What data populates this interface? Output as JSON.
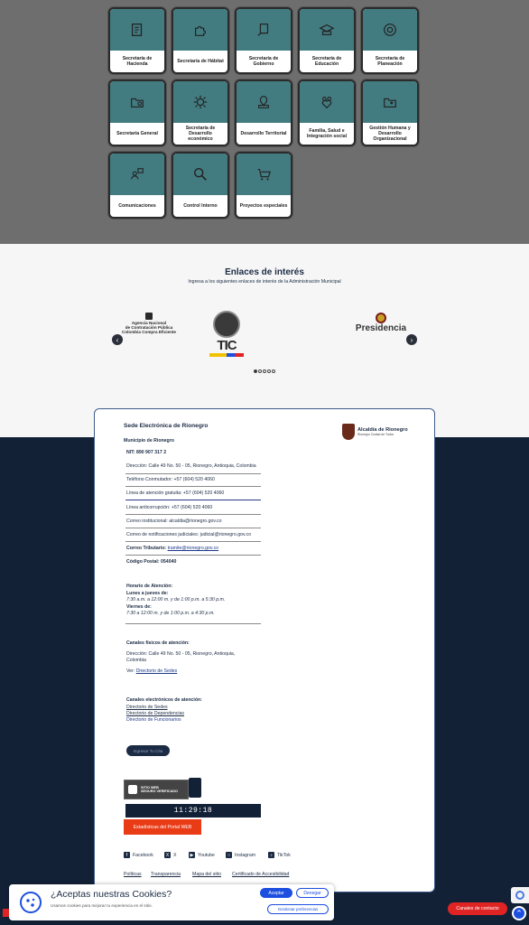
{
  "tiles": [
    {
      "label": "Secretaría de Hacienda",
      "icon": "document-money-icon"
    },
    {
      "label": "Secretaría de Hábitat",
      "icon": "puzzle-icon"
    },
    {
      "label": "Secretaría de Gobierno",
      "icon": "hand-document-icon"
    },
    {
      "label": "Secretaría de Educación",
      "icon": "graduation-cap-icon"
    },
    {
      "label": "Secretaría de Planeación",
      "icon": "target-icon"
    },
    {
      "label": "Secretaría General",
      "icon": "folder-gear-icon"
    },
    {
      "label": "Secretaría de Desarrollo económico",
      "icon": "gear-icon"
    },
    {
      "label": "Desarrollo Territorial",
      "icon": "map-pin-icon"
    },
    {
      "label": "Familia, Salud e Integración social",
      "icon": "family-heart-icon"
    },
    {
      "label": "Gestión Humana y Desarrollo Organizacional",
      "icon": "folder-people-icon"
    },
    {
      "label": "Comunicaciones",
      "icon": "people-chat-icon"
    },
    {
      "label": "Control Interno",
      "icon": "magnifier-icon"
    },
    {
      "label": "Proyectos especiales",
      "icon": "chart-cart-icon"
    }
  ],
  "links": {
    "title": "Enlaces de interés",
    "subtitle": "Ingresa a los siguientes enlaces de interés de la Administración Municipal",
    "logo1_line1": "Agencia Nacional",
    "logo1_line2": "de Contratación Pública",
    "logo1_line3": "Colombia Compra Eficiente",
    "logo2": "TIC",
    "logo3": "Presidencia"
  },
  "footer": {
    "title": "Sede Electrónica de Rionegro",
    "subtitle": "Municipio de Rionegro",
    "nit": "NIT: 890 907 317 2",
    "address": "Dirección: Calle 49 No. 50 - 05, Rionegro, Antioquia, Colombia",
    "phone": "Teléfono Conmutador: +57 (604) 520 4060",
    "line_attention": "Línea de atención gratuita: +57 (604) 520 4060",
    "line_anticorruption": "Línea anticorrupción: +57 (604) 520 4060",
    "email_institutional": "Correo institucional: alcaldia@rionegro.gov.co",
    "email_judicial": "Correo de notificaciones judiciales: judicial@rionegro.gov.co",
    "email_label": "Correo Tributario:",
    "email_tax": "tramite@rionegro.gov.co",
    "postal": "Código Postal: 054040",
    "hours_title": "Horario de Atención:",
    "hours_days1": "Lunes a jueves de:",
    "hours_time1": "7:30 a.m. a 12:00 m. y de 1:00 p.m. a 5:30 p.m.",
    "hours_days2": "Viernes de:",
    "hours_time2": "7:30 a 12:00 m. y de 1:00 p.m. a 4:30 p.m.",
    "channels_title": "Canales físicos de atención:",
    "channels_address_1": "Dirección: Calle 49 No. 50 - 05, Rionegro, Antioquia,",
    "channels_address_2": "Colombia",
    "see_label": "Ver:",
    "see_link": "Directorio de Sedes",
    "electronic_title": "Canales electrónicos de atención:",
    "dir_sedes": "Directorio de Sedes",
    "dir_dependencias": "Directorio de Dependencias",
    "dir_funcionarios": "Directorio de Funcionarios",
    "pill": "Ingresar Tu Cita",
    "brand_name": "Alcaldía de Rionegro",
    "brand_tag": "Rionegro Ciudad de Todos",
    "seal_line1": "SITIO WEB",
    "seal_line2": "SEGURO VERIFICADO",
    "clock": "11:29:18",
    "stats_button": "Estadísticas del Portal WEB",
    "social": [
      "Facebook",
      "X",
      "Youtube",
      "Instagram",
      "TikTok"
    ],
    "legal": [
      "Políticas",
      "Transparencia",
      "Mapa del sitio",
      "Certificado de Accesibilidad"
    ]
  },
  "cookies": {
    "title": "¿Aceptas nuestras Cookies?",
    "text": "Usamos cookies para mejorar tu experiencia en el sitio.",
    "accept": "Aceptar",
    "deny": "Denegar",
    "manage": "Gestionar preferencias"
  },
  "contact_button": "Canales de contacto",
  "colors": {
    "teal": "#427b80",
    "navy": "#132137",
    "red": "#e02424",
    "blue": "#1c4fe0"
  }
}
